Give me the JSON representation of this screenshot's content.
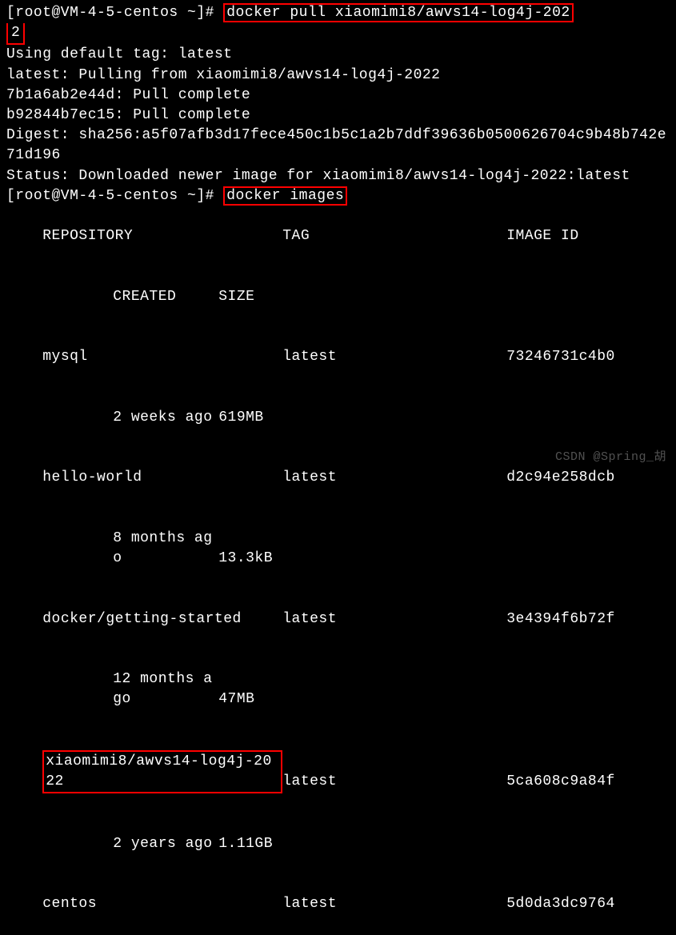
{
  "prompt1": "[root@VM-4-5-centos ~]# ",
  "cmd1_part1": "docker pull xiaomimi8/awvs14-log4j-202",
  "cmd1_part2": "2",
  "output": {
    "l1": "Using default tag: latest",
    "l2": "latest: Pulling from xiaomimi8/awvs14-log4j-2022",
    "l3": "7b1a6ab2e44d: Pull complete",
    "l4": "b92844b7ec15: Pull complete",
    "l5": "Digest: sha256:a5f07afb3d17fece450c1b5c1a2b7ddf39636b0500626704c9b48b742e71d196",
    "l6": "Status: Downloaded newer image for xiaomimi8/awvs14-log4j-2022:latest"
  },
  "prompt2": "[root@VM-4-5-centos ~]# ",
  "cmd2": "docker images",
  "table": {
    "headers": {
      "repo": "REPOSITORY",
      "tag": "TAG",
      "id": "IMAGE ID",
      "created": "CREATED",
      "size": "SIZE"
    },
    "rows": [
      {
        "repo": "mysql",
        "tag": "latest",
        "id": "73246731c4b0",
        "created": "2 weeks ago",
        "size": "619MB"
      },
      {
        "repo": "hello-world",
        "tag": "latest",
        "id": "d2c94e258dcb",
        "created": "8 months ago",
        "size": "13.3kB"
      },
      {
        "repo": "docker/getting-started",
        "tag": "latest",
        "id": "3e4394f6b72f",
        "created": "12 months ago",
        "size": "47MB"
      },
      {
        "repo": "xiaomimi8/awvs14-log4j-2022",
        "tag": "latest",
        "id": "5ca608c9a84f",
        "created": "2 years ago",
        "size": "1.11GB"
      },
      {
        "repo": "centos",
        "tag": "latest",
        "id": "5d0da3dc9764",
        "created": "",
        "size": ""
      }
    ]
  },
  "watermark": "CSDN @Spring_胡"
}
